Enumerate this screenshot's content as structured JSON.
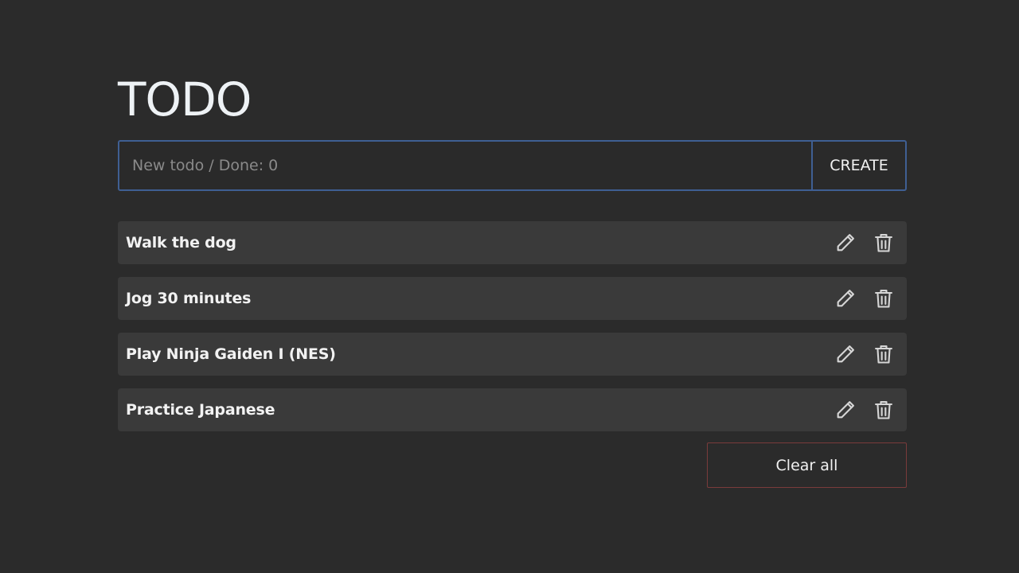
{
  "app": {
    "title": "TODO"
  },
  "create": {
    "placeholder": "New todo / Done: 0",
    "value": "",
    "button_label": "CREATE"
  },
  "todos": [
    {
      "text": "Walk the dog",
      "edit_icon": "pencil-icon",
      "delete_icon": "trash-icon"
    },
    {
      "text": "Jog 30 minutes",
      "edit_icon": "pencil-icon",
      "delete_icon": "trash-icon"
    },
    {
      "text": "Play Ninja Gaiden I (NES)",
      "edit_icon": "pencil-icon",
      "delete_icon": "trash-icon"
    },
    {
      "text": "Practice Japanese",
      "edit_icon": "pencil-icon",
      "delete_icon": "trash-icon"
    }
  ],
  "footer": {
    "clear_label": "Clear all"
  },
  "colors": {
    "background": "#2b2b2b",
    "item_background": "#3a3a3a",
    "accent_border": "#3f5f93",
    "danger_border": "#7a3b3b"
  }
}
